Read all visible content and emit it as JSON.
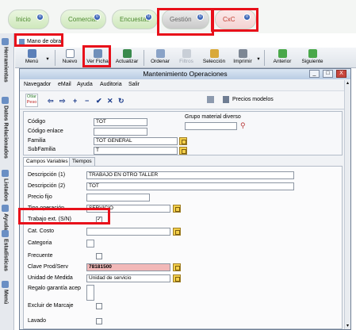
{
  "modules": [
    {
      "label": "Inicio",
      "badge": "0"
    },
    {
      "label": "Comercial",
      "badge": "0"
    },
    {
      "label": "Encuestas",
      "badge": "0"
    },
    {
      "label": "Gestión",
      "badge": "0"
    },
    {
      "label": "CxC",
      "badge": "0"
    }
  ],
  "sidebar": {
    "items": [
      "Herramientas",
      "Datos Relacionados",
      "Listados",
      "Ayuda",
      "Estadísticas",
      "Menú"
    ]
  },
  "subtab": {
    "label": "Mano de obra"
  },
  "toolbar": {
    "items": [
      "Menú",
      "Nuevo",
      "Ver Ficha",
      "Actualizar",
      "Ordenar",
      "Filtros",
      "Selección",
      "Imprimir",
      "Anterior",
      "Siguiente"
    ]
  },
  "window": {
    "title": "Mantenimiento Operaciones",
    "controls": [
      "_",
      "□",
      "X"
    ]
  },
  "menu": [
    "Navegador",
    "eMail",
    "Ayuda",
    "Auditoria",
    "Salir"
  ],
  "action_toolbar": {
    "badge_top": "Otlar",
    "badge_bottom": "Peso",
    "nav_symbols": [
      "⇦",
      "⇨",
      "+",
      "−",
      "✔",
      "✕",
      "↻"
    ],
    "precios_label": "Precios modelos"
  },
  "header_form": {
    "codigo_label": "Código",
    "codigo_value": "TOT",
    "enlace_label": "Código enlace",
    "enlace_value": "",
    "familia_label": "Familia",
    "familia_value": "TOT GENERAL",
    "subfamilia_label": "SubFamilia",
    "subfamilia_value": "T",
    "grupo_label": "Grupo material diverso",
    "grupo_value": ""
  },
  "tabs": [
    "Campos Variables",
    "Tiempos"
  ],
  "fields": [
    {
      "label": "Descripción (1)",
      "value": "TRABAJO EN OTRO TALLER"
    },
    {
      "label": "Descripción (2)",
      "value": "TOT"
    },
    {
      "label": "Precio fijo",
      "value": ""
    },
    {
      "label": "Tipo operación",
      "value": "SERVICIO"
    },
    {
      "label": "Trabajo ext. (S/N)",
      "value": "✓"
    },
    {
      "label": "Cat. Costo",
      "value": ""
    },
    {
      "label": "Categoria",
      "value": ""
    },
    {
      "label": "Frecuente",
      "value": ""
    },
    {
      "label": "Clave Prod/Serv",
      "value": "78181500"
    },
    {
      "label": "Unidad de Medida",
      "value": "Unidad de servicio"
    },
    {
      "label": "Regalo garantía acep",
      "value": ""
    },
    {
      "label": "Excluir de Marcaje",
      "value": ""
    },
    {
      "label": "Lavado",
      "value": ""
    }
  ],
  "colors": {
    "highlight": "#e8101a",
    "clave_bg": "#f2b8b8",
    "module_green": "#4d8a2f",
    "cxc_red": "#c0392b"
  }
}
